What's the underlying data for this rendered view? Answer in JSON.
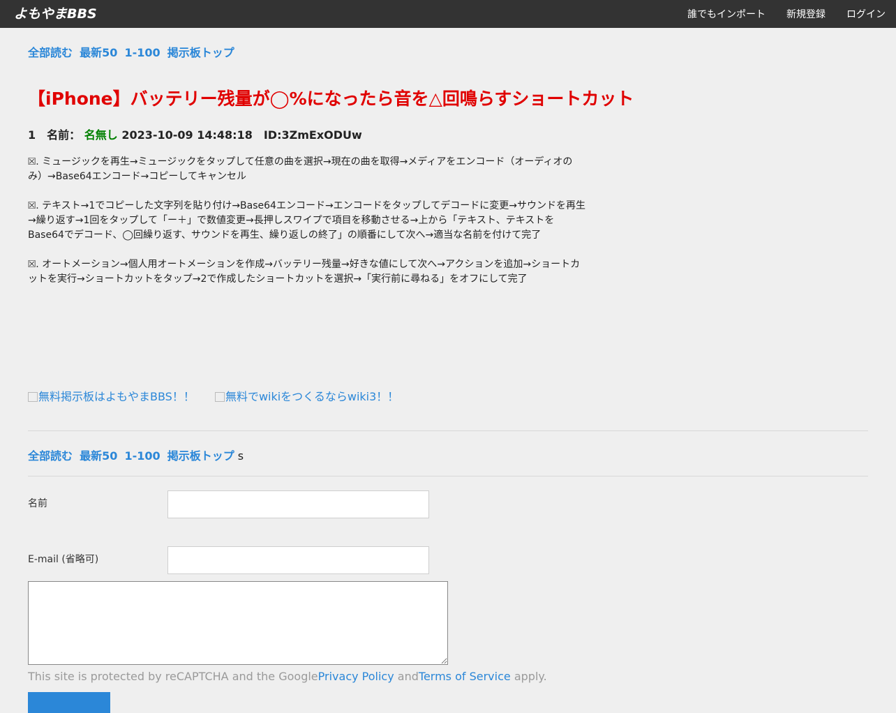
{
  "header": {
    "logo": "よもやまBBS",
    "nav": [
      "誰でもインポート",
      "新規登録",
      "ログイン"
    ]
  },
  "thread_nav": {
    "links": [
      "全部読む",
      "最新50",
      "1-100",
      "掲示板トップ"
    ],
    "bottom_suffix": "s"
  },
  "thread": {
    "title": "【iPhone】バッテリー残量が◯%になったら音を△回鳴らすショートカット"
  },
  "post": {
    "number": "1",
    "name_label": "名前：",
    "name": "名無し",
    "date": "2023-10-09 14:48:18",
    "id": "ID:3ZmExODUw",
    "paragraphs": [
      "⮽. ミュージックを再生→ミュージックをタップして任意の曲を選択→現在の曲を取得→メディアをエンコード（オーディオのみ）→Base64エンコード→コピーしてキャンセル",
      "⮽. テキスト→1でコピーした文字列を貼り付け→Base64エンコード→エンコードをタップしてデコードに変更→サウンドを再生→繰り返す→1回をタップして「ー＋」で数値変更→長押しスワイプで項目を移動させる→上から「テキスト、テキストをBase64でデコード、◯回繰り返す、サウンドを再生、繰り返しの終了」の順番にして次へ→適当な名前を付けて完了",
      "⮽. オートメーション→個人用オートメーションを作成→バッテリー残量→好きな値にして次へ→アクションを追加→ショートカットを実行→ショートカットをタップ→2で作成したショートカットを選択→「実行前に尋ねる」をオフにして完了"
    ]
  },
  "banners": [
    "無料掲示板はよもやまBBS！！",
    "無料でwikiをつくるならwiki3！！"
  ],
  "form": {
    "name_label": "名前",
    "email_label": "E-mail (省略可)",
    "name_value": "",
    "email_value": "",
    "body_value": ""
  },
  "captcha": {
    "prefix": "This site is protected by reCAPTCHA and the Google",
    "privacy": "Privacy Policy",
    "and": " and",
    "terms": "Terms of Service",
    "suffix": " apply."
  },
  "colors": {
    "topbar": "#333333",
    "link": "#2b87d8",
    "title": "#e00000",
    "name": "#008000"
  }
}
